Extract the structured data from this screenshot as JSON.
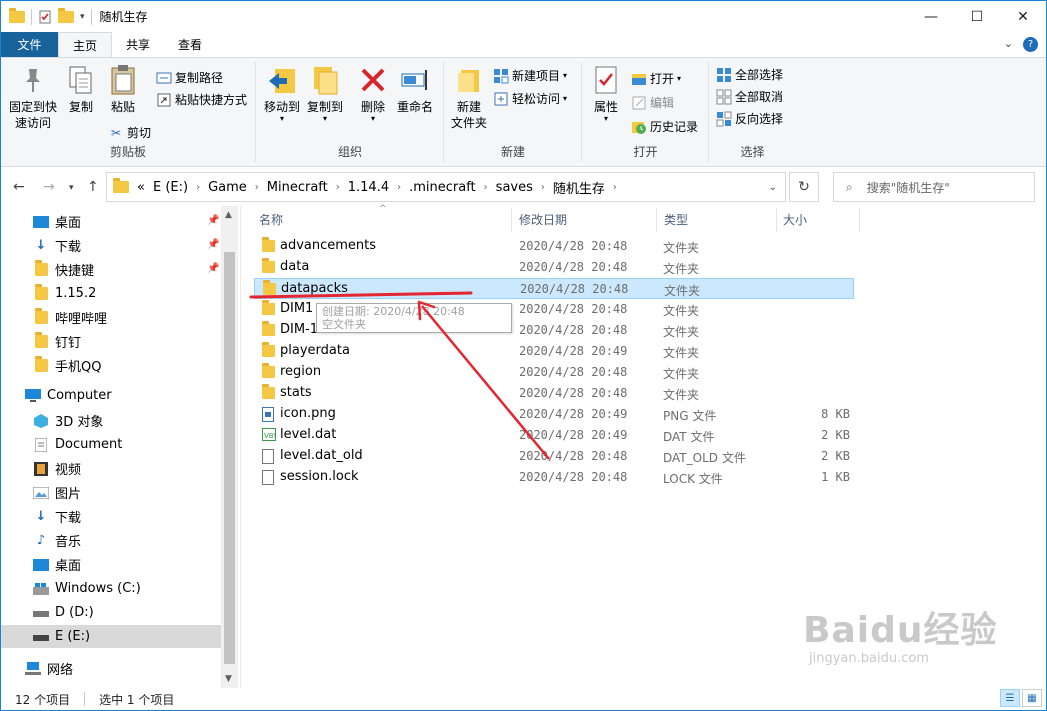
{
  "window": {
    "title": "随机生存"
  },
  "tabs": [
    "文件",
    "主页",
    "共享",
    "查看"
  ],
  "ribbon": {
    "clipboard": {
      "label": "剪贴板",
      "pin_line1": "固定到快",
      "pin_line2": "速访问",
      "copy": "复制",
      "paste": "粘贴",
      "copy_path": "复制路径",
      "paste_shortcut": "粘贴快捷方式",
      "cut": "剪切"
    },
    "organize": {
      "label": "组织",
      "move_to": "移动到",
      "copy_to": "复制到",
      "delete": "删除",
      "rename": "重命名"
    },
    "new": {
      "label": "新建",
      "new_folder_line1": "新建",
      "new_folder_line2": "文件夹",
      "new_item": "新建项目",
      "easy_access": "轻松访问"
    },
    "open": {
      "label": "打开",
      "properties": "属性",
      "open": "打开",
      "edit": "编辑",
      "history": "历史记录"
    },
    "select": {
      "label": "选择",
      "select_all": "全部选择",
      "select_none": "全部取消",
      "invert": "反向选择"
    }
  },
  "address": {
    "prefix": "«",
    "crumbs": [
      "E (E:)",
      "Game",
      "Minecraft",
      "1.14.4",
      ".minecraft",
      "saves",
      "随机生存"
    ],
    "search_placeholder": "搜索\"随机生存\""
  },
  "nav": {
    "quick": [
      {
        "label": "桌面",
        "pinned": true
      },
      {
        "label": "下载",
        "pinned": true
      },
      {
        "label": "快捷键",
        "pinned": true
      },
      {
        "label": "1.15.2",
        "pinned": false
      },
      {
        "label": "哔哩哔哩",
        "pinned": false
      },
      {
        "label": "钉钉",
        "pinned": false
      },
      {
        "label": "手机QQ",
        "pinned": false
      }
    ],
    "computer": "Computer",
    "computer_items": [
      "3D 对象",
      "Document",
      "视频",
      "图片",
      "下载",
      "音乐",
      "桌面",
      "Windows (C:)",
      "D (D:)",
      "E (E:)"
    ],
    "network": "网络"
  },
  "columns": {
    "name": "名称",
    "date": "修改日期",
    "type": "类型",
    "size": "大小"
  },
  "files": [
    {
      "name": "advancements",
      "date": "2020/4/28 20:48",
      "type": "文件夹",
      "size": "",
      "kind": "folder"
    },
    {
      "name": "data",
      "date": "2020/4/28 20:48",
      "type": "文件夹",
      "size": "",
      "kind": "folder"
    },
    {
      "name": "datapacks",
      "date": "2020/4/28 20:48",
      "type": "文件夹",
      "size": "",
      "kind": "folder",
      "selected": true
    },
    {
      "name": "DIM1",
      "date": "2020/4/28 20:48",
      "type": "文件夹",
      "size": "",
      "kind": "folder"
    },
    {
      "name": "DIM-1",
      "date": "2020/4/28 20:48",
      "type": "文件夹",
      "size": "",
      "kind": "folder"
    },
    {
      "name": "playerdata",
      "date": "2020/4/28 20:49",
      "type": "文件夹",
      "size": "",
      "kind": "folder"
    },
    {
      "name": "region",
      "date": "2020/4/28 20:48",
      "type": "文件夹",
      "size": "",
      "kind": "folder"
    },
    {
      "name": "stats",
      "date": "2020/4/28 20:48",
      "type": "文件夹",
      "size": "",
      "kind": "folder"
    },
    {
      "name": "icon.png",
      "date": "2020/4/28 20:49",
      "type": "PNG 文件",
      "size": "8 KB",
      "kind": "png"
    },
    {
      "name": "level.dat",
      "date": "2020/4/28 20:49",
      "type": "DAT 文件",
      "size": "2 KB",
      "kind": "dat"
    },
    {
      "name": "level.dat_old",
      "date": "2020/4/28 20:48",
      "type": "DAT_OLD 文件",
      "size": "2 KB",
      "kind": "file"
    },
    {
      "name": "session.lock",
      "date": "2020/4/28 20:48",
      "type": "LOCK 文件",
      "size": "1 KB",
      "kind": "file"
    }
  ],
  "tooltip": {
    "line1": "创建日期: 2020/4/28 20:48",
    "line2": "空文件夹"
  },
  "status": {
    "count": "12 个项目",
    "selected": "选中 1 个项目"
  },
  "watermark": {
    "brand": "Baidu经验",
    "url": "jingyan.baidu.com"
  },
  "colors": {
    "file_tab": "#19639c",
    "selection": "#cce8ff",
    "annotation": "#e3262f",
    "folder": "#f5c843"
  }
}
